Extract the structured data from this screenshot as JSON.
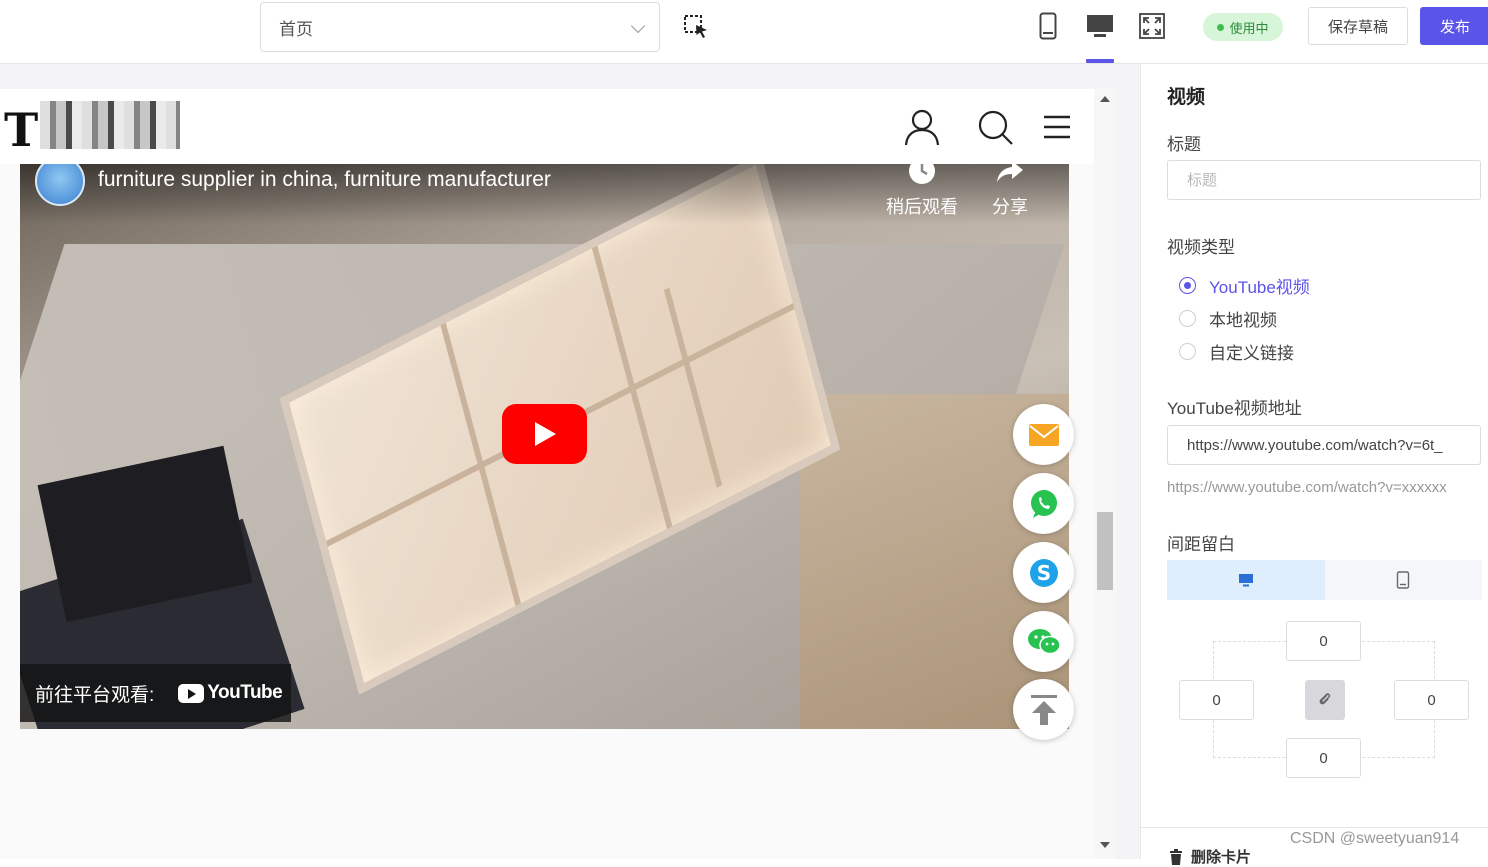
{
  "toolbar": {
    "page_select_value": "首页",
    "status_badge": "使用中",
    "save_draft_label": "保存草稿",
    "publish_label": "发布",
    "accent_color": "#5b54e8"
  },
  "site": {
    "logo_text": "T"
  },
  "video": {
    "title": "furniture supplier in china, furniture manufacturer",
    "watch_later_label": "稍后观看",
    "share_label": "分享",
    "watch_on_label": "前往平台观看:",
    "platform_logo": "YouTube"
  },
  "floating_buttons": [
    {
      "icon": "email-icon",
      "color": "#f6a623"
    },
    {
      "icon": "whatsapp-icon",
      "color": "#27c250"
    },
    {
      "icon": "skype-icon",
      "color": "#1fa3e8"
    },
    {
      "icon": "wechat-icon",
      "color": "#27c250"
    },
    {
      "icon": "back-to-top-icon",
      "color": "#888888"
    }
  ],
  "panel": {
    "title": "视频",
    "title_field_label": "标题",
    "title_field_placeholder": "标题",
    "video_type_label": "视频类型",
    "video_type_options": [
      "YouTube视频",
      "本地视频",
      "自定义链接"
    ],
    "video_type_selected": "YouTube视频",
    "url_label": "YouTube视频地址",
    "url_value": "https://www.youtube.com/watch?v=6t_",
    "url_hint": "https://www.youtube.com/watch?v=xxxxxx",
    "spacing_label": "间距留白",
    "spacing": {
      "top": "0",
      "left": "0",
      "right": "0",
      "bottom": "0"
    },
    "delete_label": "删除卡片"
  },
  "watermark": "CSDN @sweetyuan914"
}
